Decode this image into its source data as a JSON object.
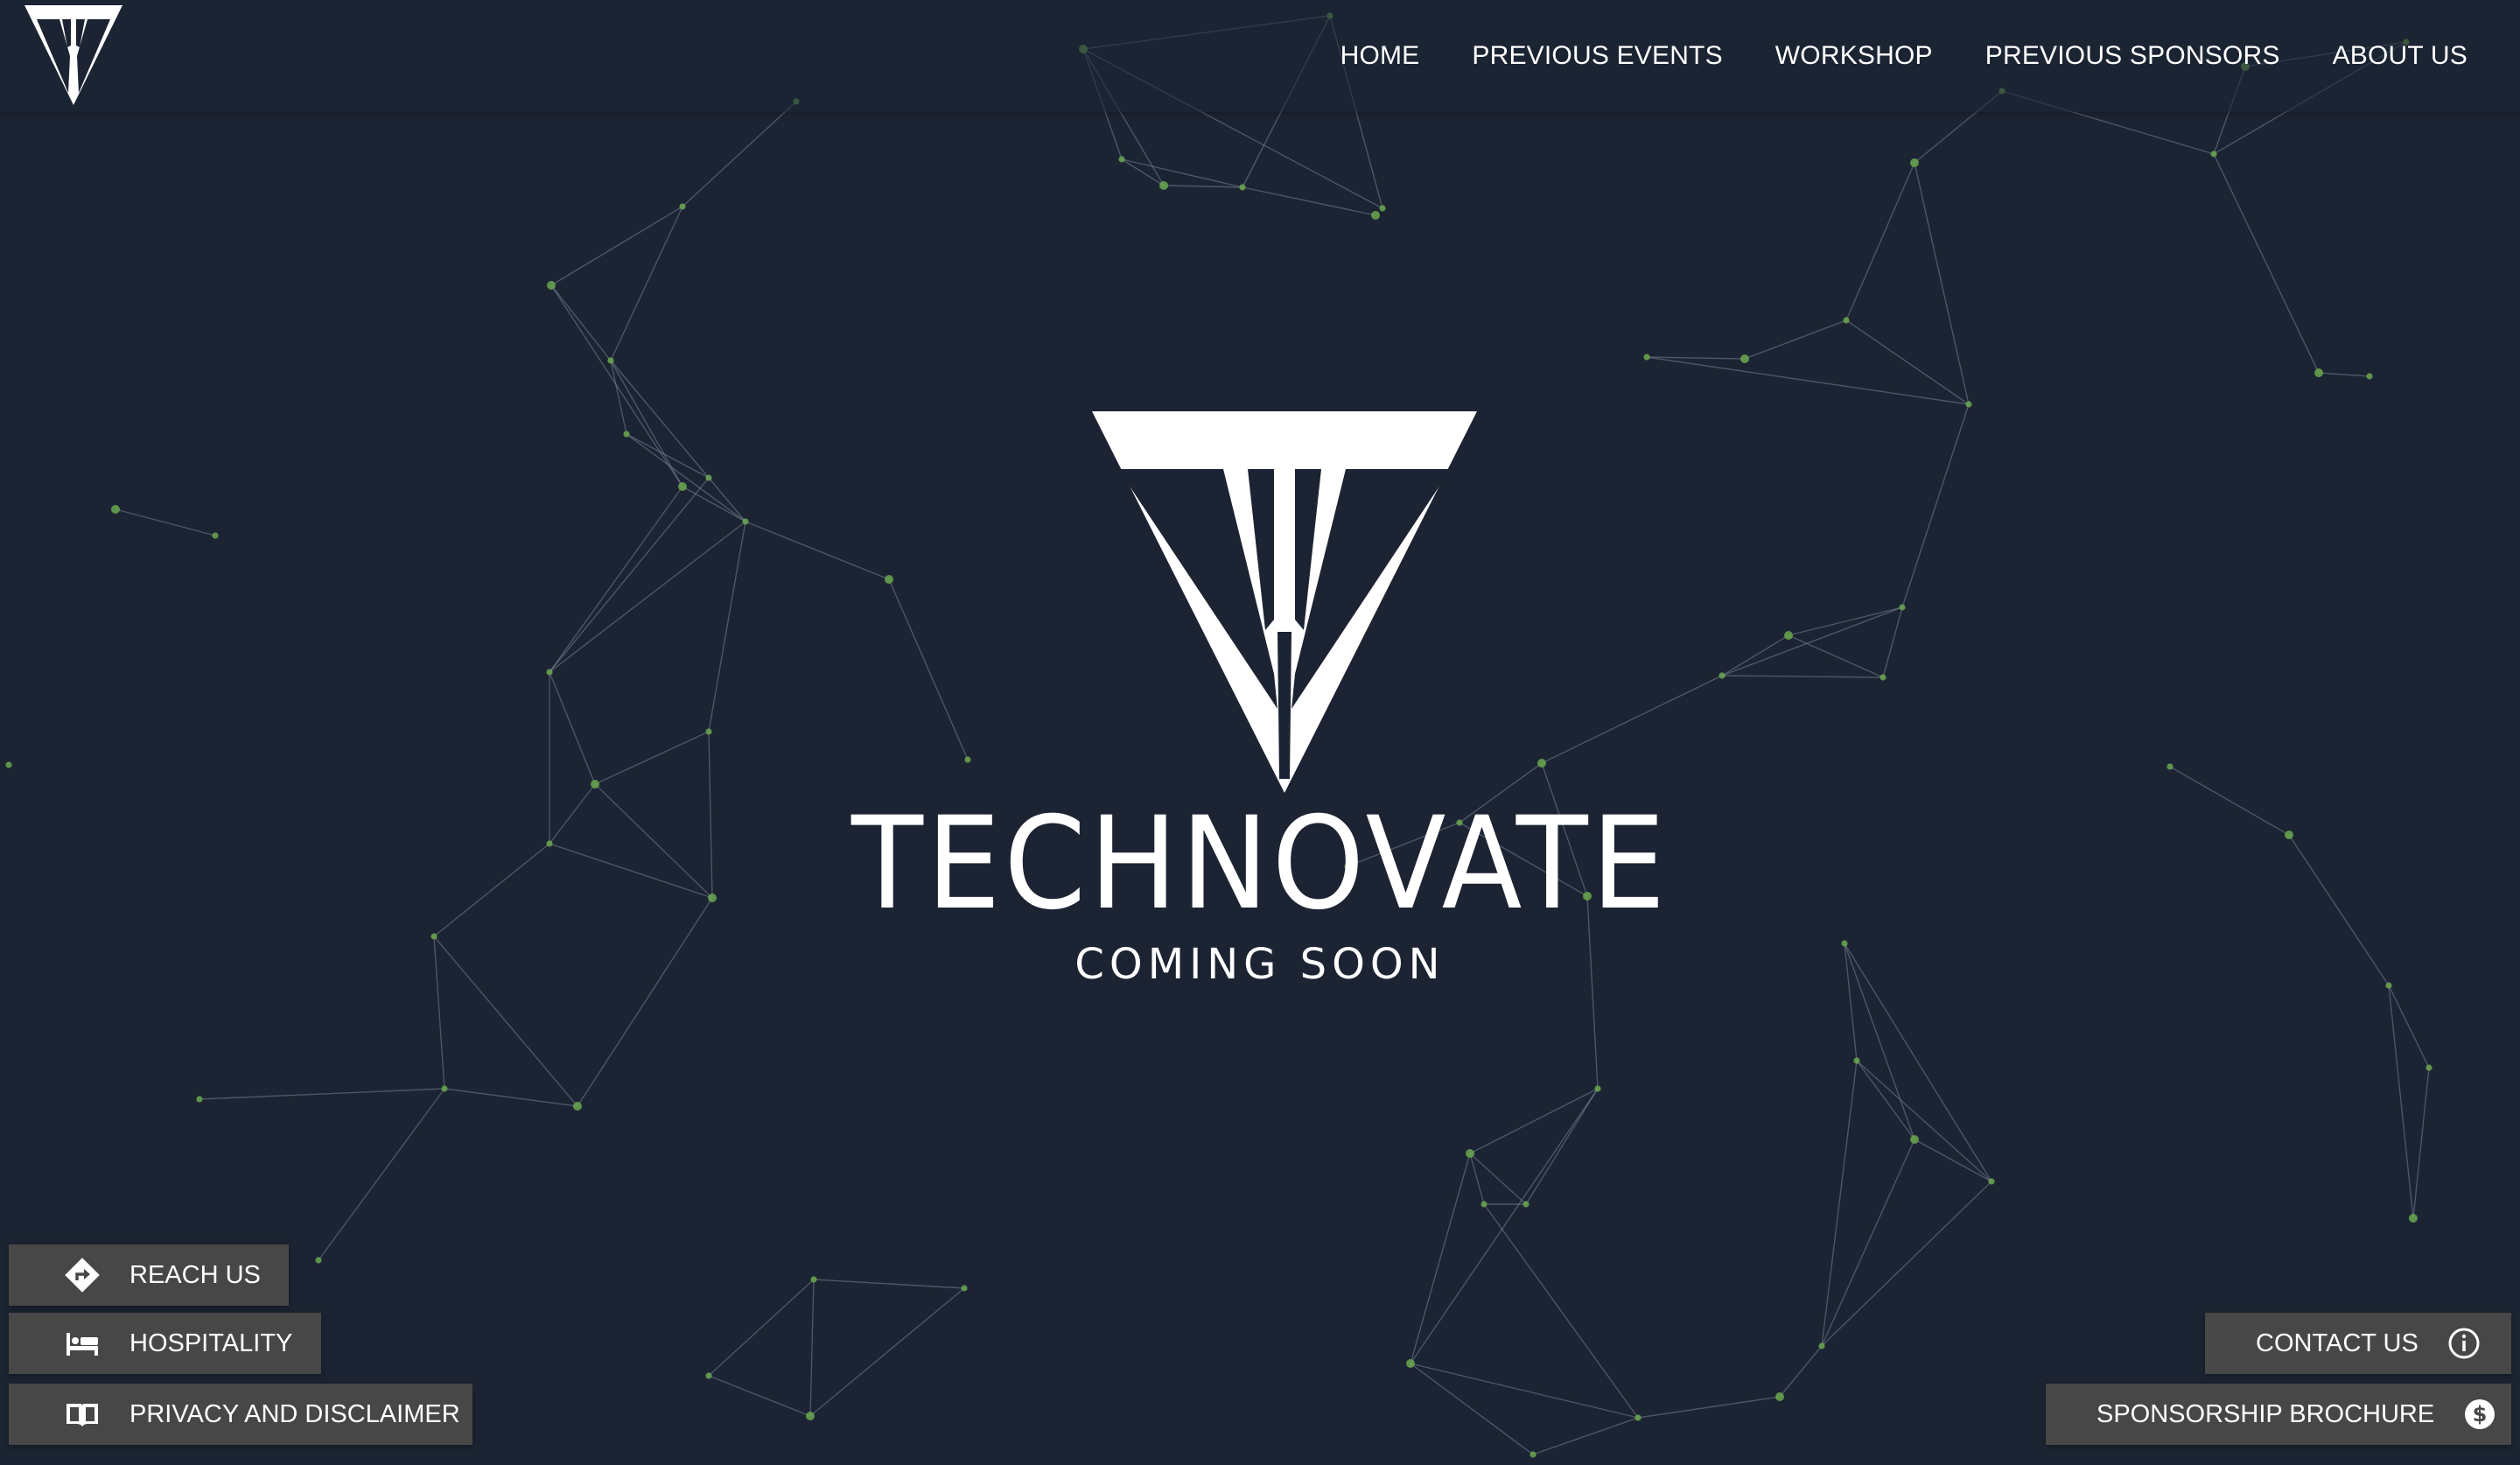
{
  "brand": {
    "name": "TECHNOVATE",
    "tagline": "COMING SOON"
  },
  "nav": {
    "items": [
      {
        "label": "HOME",
        "name": "nav-home"
      },
      {
        "label": "PREVIOUS EVENTS",
        "name": "nav-previous-events"
      },
      {
        "label": "WORKSHOP",
        "name": "nav-workshop"
      },
      {
        "label": "PREVIOUS SPONSORS",
        "name": "nav-previous-sponsors"
      },
      {
        "label": "ABOUT US",
        "name": "nav-about-us"
      }
    ]
  },
  "left_buttons": {
    "reach_us": {
      "label": "REACH US",
      "icon": "directions-icon"
    },
    "hospitality": {
      "label": "HOSPITALITY",
      "icon": "bed-icon"
    },
    "privacy": {
      "label": "PRIVACY AND DISCLAIMER",
      "icon": "book-icon"
    }
  },
  "right_buttons": {
    "contact": {
      "label": "CONTACT US",
      "icon": "info-icon"
    },
    "sponsorship": {
      "label": "SPONSORSHIP BROCHURE",
      "icon": "dollar-icon"
    }
  },
  "colors": {
    "background": "#1c2433",
    "node": "#6aa84f",
    "line": "#8a93a3",
    "button": "#474747"
  }
}
